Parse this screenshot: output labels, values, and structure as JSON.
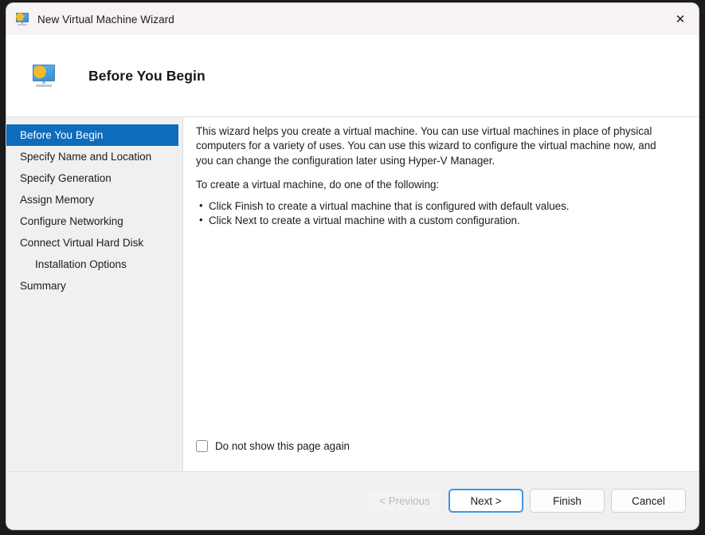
{
  "window": {
    "title": "New Virtual Machine Wizard",
    "title_icon": "virtual-machine-monitor-icon",
    "close_label": "✕"
  },
  "header": {
    "title": "Before You Begin",
    "icon": "virtual-machine-monitor-icon"
  },
  "sidebar": {
    "items": [
      {
        "label": "Before You Begin",
        "selected": true,
        "indented": false
      },
      {
        "label": "Specify Name and Location",
        "selected": false,
        "indented": false
      },
      {
        "label": "Specify Generation",
        "selected": false,
        "indented": false
      },
      {
        "label": "Assign Memory",
        "selected": false,
        "indented": false
      },
      {
        "label": "Configure Networking",
        "selected": false,
        "indented": false
      },
      {
        "label": "Connect Virtual Hard Disk",
        "selected": false,
        "indented": false
      },
      {
        "label": "Installation Options",
        "selected": false,
        "indented": true
      },
      {
        "label": "Summary",
        "selected": false,
        "indented": false
      }
    ],
    "selected_color": "#0e6cbd"
  },
  "content": {
    "paragraph1": "This wizard helps you create a virtual machine. You can use virtual machines in place of physical computers for a variety of uses. You can use this wizard to configure the virtual machine now, and you can change the configuration later using Hyper-V Manager.",
    "paragraph2": "To create a virtual machine, do one of the following:",
    "bullets": [
      "Click Finish to create a virtual machine that is configured with default values.",
      "Click Next to create a virtual machine with a custom configuration."
    ],
    "checkbox": {
      "label": "Do not show this page again",
      "checked": false
    }
  },
  "footer": {
    "buttons": [
      {
        "label": "< Previous",
        "state": "disabled"
      },
      {
        "label": "Next >",
        "state": "default"
      },
      {
        "label": "Finish",
        "state": "normal"
      },
      {
        "label": "Cancel",
        "state": "normal"
      }
    ]
  }
}
